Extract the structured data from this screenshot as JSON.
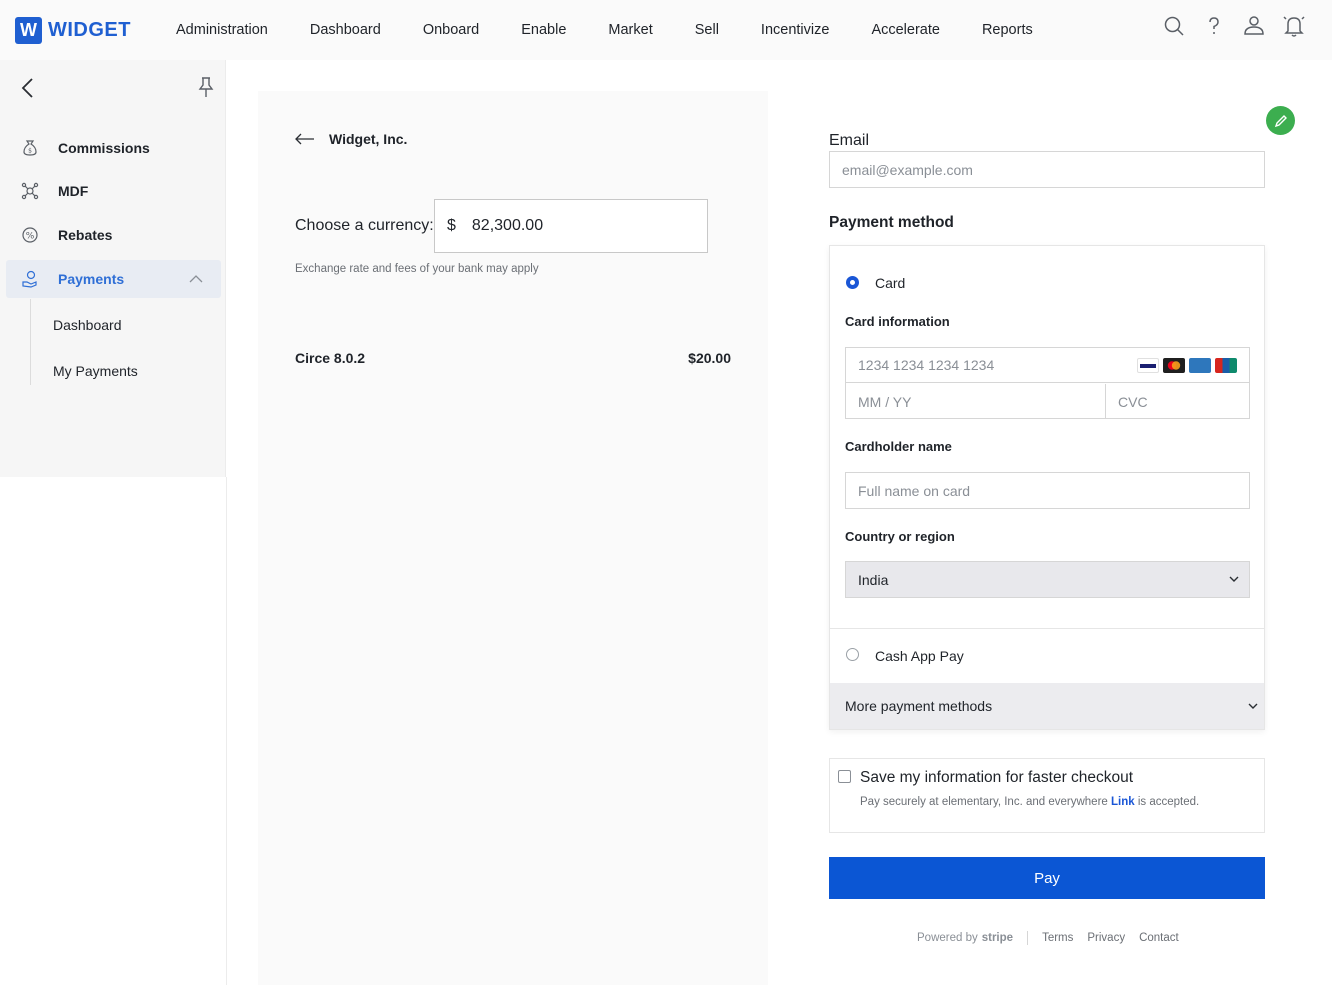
{
  "brand": {
    "logo_letter": "W",
    "name": "WIDGET",
    "color": "#1f5fd1"
  },
  "topnav": {
    "items": [
      "Administration",
      "Dashboard",
      "Onboard",
      "Enable",
      "Market",
      "Sell",
      "Incentivize",
      "Accelerate",
      "Reports"
    ],
    "icons": [
      "search-icon",
      "help-icon",
      "user-icon",
      "bell-icon"
    ]
  },
  "sidebar": {
    "items": [
      {
        "label": "Commissions",
        "icon": "money-bag-icon"
      },
      {
        "label": "MDF",
        "icon": "network-icon"
      },
      {
        "label": "Rebates",
        "icon": "percent-icon"
      },
      {
        "label": "Payments",
        "icon": "payment-hand-icon",
        "active": true
      }
    ],
    "sub_items": [
      "Dashboard",
      "My Payments"
    ],
    "active_color": "#2f6fd6"
  },
  "summary": {
    "merchant": "Widget, Inc.",
    "currency_label": "Choose a currency:",
    "currency_symbol": "$",
    "amount": "82,300.00",
    "fx_note": "Exchange rate and fees of your bank may apply",
    "line_item": {
      "name": "Circe 8.0.2",
      "price": "$20.00"
    }
  },
  "form": {
    "email_label": "Email",
    "email_placeholder": "email@example.com",
    "payment_method_title": "Payment method",
    "card_option": "Card",
    "card_info_label": "Card information",
    "card_number_placeholder": "1234 1234 1234 1234",
    "expiry_placeholder": "MM / YY",
    "cvc_placeholder": "CVC",
    "cardholder_label": "Cardholder name",
    "cardholder_placeholder": "Full name on card",
    "country_label": "Country or region",
    "country_value": "India",
    "cashapp_option": "Cash App Pay",
    "more_methods": "More payment methods",
    "save_title": "Save my information for faster checkout",
    "save_sub_pre": "Pay securely at elementary, Inc. and everywhere ",
    "save_sub_link": "Link",
    "save_sub_post": " is accepted.",
    "pay_label": "Pay",
    "pay_color": "#0b56d4"
  },
  "footer": {
    "powered_by": "Powered by",
    "stripe": "stripe",
    "links": [
      "Terms",
      "Privacy",
      "Contact"
    ]
  }
}
